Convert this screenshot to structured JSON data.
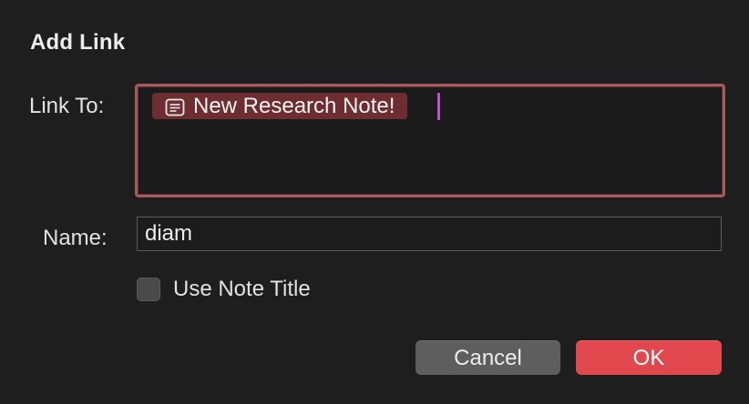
{
  "dialog": {
    "title": "Add Link",
    "link_to_label": "Link To:",
    "name_label": "Name:",
    "link_token": {
      "text": "New Research Note!",
      "icon": "note-icon"
    },
    "name_value": "diam",
    "use_note_title_label": "Use Note Title",
    "use_note_title_checked": false,
    "cancel_label": "Cancel",
    "ok_label": "OK"
  },
  "colors": {
    "background": "#1e1e1e",
    "focus_ring": "#a8595c",
    "token_bg": "#6e2e31",
    "caret": "#b557c7",
    "ok_button": "#e0484e",
    "cancel_button": "#5e5e5e"
  }
}
